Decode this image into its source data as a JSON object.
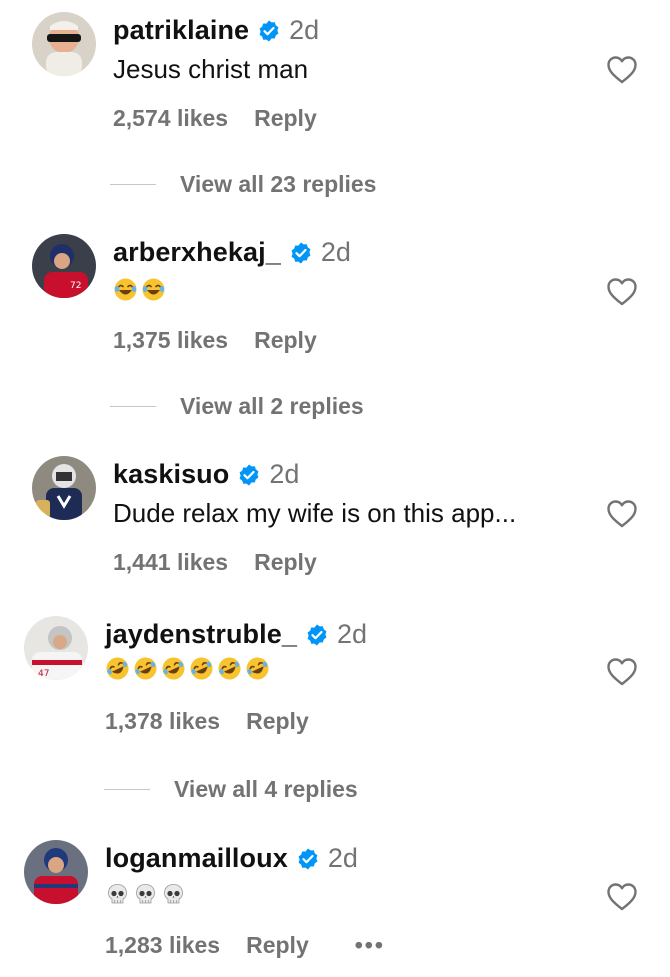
{
  "comments": [
    {
      "username": "patriklaine",
      "time": "2d",
      "text": "Jesus christ man",
      "likes": "2,574 likes",
      "reply": "Reply",
      "view_replies": "View all 23 replies"
    },
    {
      "username": "arberxhekaj_",
      "time": "2d",
      "emoji": [
        "😂",
        "😂"
      ],
      "likes": "1,375 likes",
      "reply": "Reply",
      "view_replies": "View all 2 replies"
    },
    {
      "username": "kaskisuo",
      "time": "2d",
      "text": "Dude relax my wife is on this app...",
      "likes": "1,441 likes",
      "reply": "Reply"
    },
    {
      "username": "jaydenstruble_",
      "time": "2d",
      "emoji": [
        "🤣",
        "🤣",
        "🤣",
        "🤣",
        "🤣",
        "🤣"
      ],
      "likes": "1,378 likes",
      "reply": "Reply",
      "view_replies": "View all 4 replies"
    },
    {
      "username": "loganmailloux",
      "time": "2d",
      "emoji": [
        "💀",
        "💀",
        "💀"
      ],
      "likes": "1,283 likes",
      "reply": "Reply",
      "more": "•••"
    }
  ],
  "colors": {
    "text": "#111111",
    "secondary": "#737373",
    "verified": "#0095f6",
    "divider": "#c7c7c7"
  },
  "icons": {
    "verified": "verified-badge-icon",
    "like": "heart-outline-icon",
    "more": "more-options-icon"
  }
}
